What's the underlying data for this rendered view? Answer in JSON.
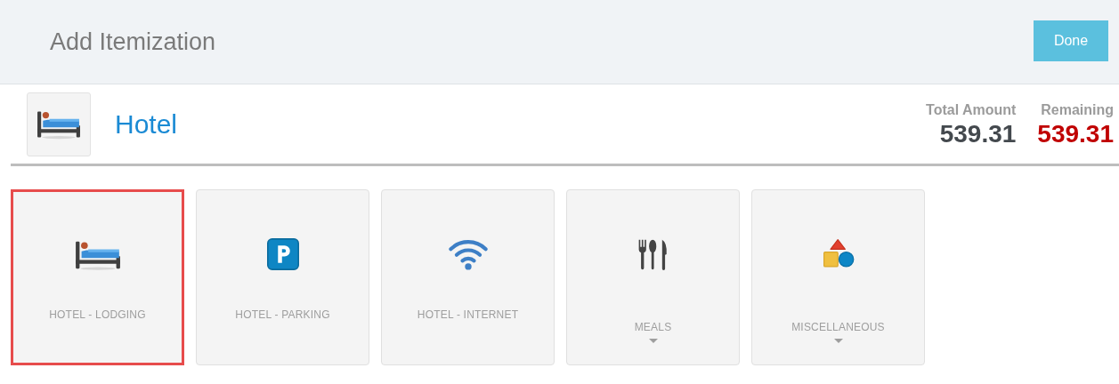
{
  "header": {
    "title": "Add Itemization",
    "done_button": "Done"
  },
  "expense": {
    "kind": "bed",
    "name": "Hotel",
    "total_label": "Total Amount",
    "total": "539.31",
    "remaining_label": "Remaining",
    "remaining": "539.31"
  },
  "tiles": [
    {
      "kind": "bed",
      "label": "HOTEL - LODGING",
      "selected": true,
      "expandable": false
    },
    {
      "kind": "parking",
      "label": "HOTEL - PARKING",
      "selected": false,
      "expandable": false
    },
    {
      "kind": "wifi",
      "label": "HOTEL - INTERNET",
      "selected": false,
      "expandable": false
    },
    {
      "kind": "cutlery",
      "label": "MEALS",
      "selected": false,
      "expandable": true
    },
    {
      "kind": "shapes",
      "label": "MISCELLANEOUS",
      "selected": false,
      "expandable": true
    }
  ]
}
